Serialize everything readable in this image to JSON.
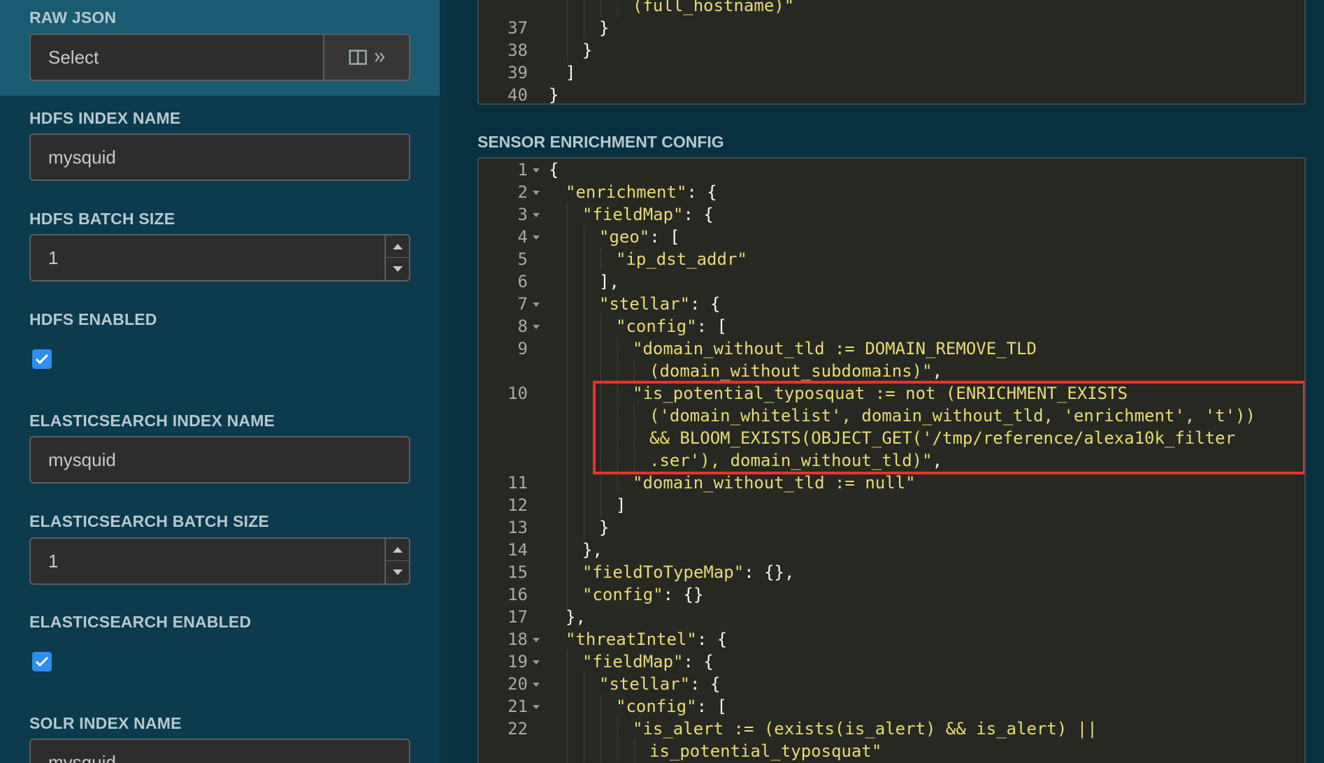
{
  "sidebar": {
    "raw_json": {
      "label": "RAW JSON",
      "value": "Select"
    },
    "hdfs_index_name": {
      "label": "HDFS INDEX NAME",
      "value": "mysquid"
    },
    "hdfs_batch_size": {
      "label": "HDFS BATCH SIZE",
      "value": "1"
    },
    "hdfs_enabled": {
      "label": "HDFS ENABLED",
      "checked": true
    },
    "es_index_name": {
      "label": "ELASTICSEARCH INDEX NAME",
      "value": "mysquid"
    },
    "es_batch_size": {
      "label": "ELASTICSEARCH BATCH SIZE",
      "value": "1"
    },
    "es_enabled": {
      "label": "ELASTICSEARCH ENABLED",
      "checked": true
    },
    "solr_index_name": {
      "label": "SOLR INDEX NAME",
      "value": "mysquid"
    }
  },
  "editor_top": {
    "lines": [
      {
        "n": "",
        "indent": 5,
        "text": "(full_hostname)\"",
        "kind": "str",
        "indentPx": 145
      },
      {
        "n": "37",
        "indent": 3,
        "text": "}",
        "kind": "plain"
      },
      {
        "n": "38",
        "indent": 2,
        "text": "}",
        "kind": "plain"
      },
      {
        "n": "39",
        "indent": 1,
        "text": "]",
        "kind": "plain"
      },
      {
        "n": "40",
        "indent": 0,
        "text": "}",
        "kind": "plain"
      }
    ]
  },
  "enrichment_config": {
    "title": "SENSOR ENRICHMENT CONFIG",
    "lines": [
      {
        "n": "1",
        "fold": true,
        "indent": 0,
        "parts": [
          [
            "{",
            "p"
          ]
        ]
      },
      {
        "n": "2",
        "fold": true,
        "indent": 1,
        "parts": [
          [
            "\"enrichment\"",
            "s"
          ],
          [
            ": {",
            "p"
          ]
        ]
      },
      {
        "n": "3",
        "fold": true,
        "indent": 2,
        "parts": [
          [
            "\"fieldMap\"",
            "s"
          ],
          [
            ": {",
            "p"
          ]
        ]
      },
      {
        "n": "4",
        "fold": true,
        "indent": 3,
        "parts": [
          [
            "\"geo\"",
            "s"
          ],
          [
            ": [",
            "p"
          ]
        ]
      },
      {
        "n": "5",
        "fold": false,
        "indent": 4,
        "parts": [
          [
            "\"ip_dst_addr\"",
            "s"
          ]
        ]
      },
      {
        "n": "6",
        "fold": false,
        "indent": 3,
        "parts": [
          [
            "],",
            "p"
          ]
        ]
      },
      {
        "n": "7",
        "fold": true,
        "indent": 3,
        "parts": [
          [
            "\"stellar\"",
            "s"
          ],
          [
            ": {",
            "p"
          ]
        ]
      },
      {
        "n": "8",
        "fold": true,
        "indent": 4,
        "parts": [
          [
            "\"config\"",
            "s"
          ],
          [
            ": [",
            "p"
          ]
        ]
      },
      {
        "n": "9",
        "fold": false,
        "indent": 5,
        "parts": [
          [
            "\"domain_without_tld := DOMAIN_REMOVE_TLD",
            "s"
          ]
        ]
      },
      {
        "n": "",
        "fold": false,
        "indent": 6,
        "parts": [
          [
            "(domain_without_subdomains)\"",
            "s"
          ],
          [
            ",",
            "p"
          ]
        ]
      },
      {
        "n": "10",
        "fold": false,
        "indent": 5,
        "parts": [
          [
            "\"is_potential_typosquat := not (ENRICHMENT_EXISTS",
            "s"
          ]
        ]
      },
      {
        "n": "",
        "fold": false,
        "indent": 6,
        "parts": [
          [
            "('domain_whitelist', domain_without_tld, 'enrichment', 't'))",
            "s"
          ]
        ]
      },
      {
        "n": "",
        "fold": false,
        "indent": 6,
        "parts": [
          [
            "&& BLOOM_EXISTS(OBJECT_GET('/tmp/reference/alexa10k_filter",
            "s"
          ]
        ]
      },
      {
        "n": "",
        "fold": false,
        "indent": 6,
        "parts": [
          [
            ".ser'), domain_without_tld)\"",
            "s"
          ],
          [
            ",",
            "p"
          ]
        ]
      },
      {
        "n": "11",
        "fold": false,
        "indent": 5,
        "parts": [
          [
            "\"domain_without_tld := null\"",
            "s"
          ]
        ]
      },
      {
        "n": "12",
        "fold": false,
        "indent": 4,
        "parts": [
          [
            "]",
            "p"
          ]
        ]
      },
      {
        "n": "13",
        "fold": false,
        "indent": 3,
        "parts": [
          [
            "}",
            "p"
          ]
        ]
      },
      {
        "n": "14",
        "fold": false,
        "indent": 2,
        "parts": [
          [
            "},",
            "p"
          ]
        ]
      },
      {
        "n": "15",
        "fold": false,
        "indent": 2,
        "parts": [
          [
            "\"fieldToTypeMap\"",
            "s"
          ],
          [
            ": {},",
            "p"
          ]
        ]
      },
      {
        "n": "16",
        "fold": false,
        "indent": 2,
        "parts": [
          [
            "\"config\"",
            "s"
          ],
          [
            ": {}",
            "p"
          ]
        ]
      },
      {
        "n": "17",
        "fold": false,
        "indent": 1,
        "parts": [
          [
            "},",
            "p"
          ]
        ]
      },
      {
        "n": "18",
        "fold": true,
        "indent": 1,
        "parts": [
          [
            "\"threatIntel\"",
            "s"
          ],
          [
            ": {",
            "p"
          ]
        ]
      },
      {
        "n": "19",
        "fold": true,
        "indent": 2,
        "parts": [
          [
            "\"fieldMap\"",
            "s"
          ],
          [
            ": {",
            "p"
          ]
        ]
      },
      {
        "n": "20",
        "fold": true,
        "indent": 3,
        "parts": [
          [
            "\"stellar\"",
            "s"
          ],
          [
            ": {",
            "p"
          ]
        ]
      },
      {
        "n": "21",
        "fold": true,
        "indent": 4,
        "parts": [
          [
            "\"config\"",
            "s"
          ],
          [
            ": [",
            "p"
          ]
        ]
      },
      {
        "n": "22",
        "fold": false,
        "indent": 5,
        "parts": [
          [
            "\"is_alert := (exists(is_alert) && is_alert) ||",
            "s"
          ]
        ]
      },
      {
        "n": "",
        "fold": false,
        "indent": 6,
        "parts": [
          [
            "is_potential_typosquat\"",
            "s"
          ]
        ]
      }
    ]
  },
  "colors": {
    "highlight_box": "#e8332f",
    "string": "#e6db74",
    "editor_bg": "#272822",
    "checkbox": "#2f8ef0"
  }
}
